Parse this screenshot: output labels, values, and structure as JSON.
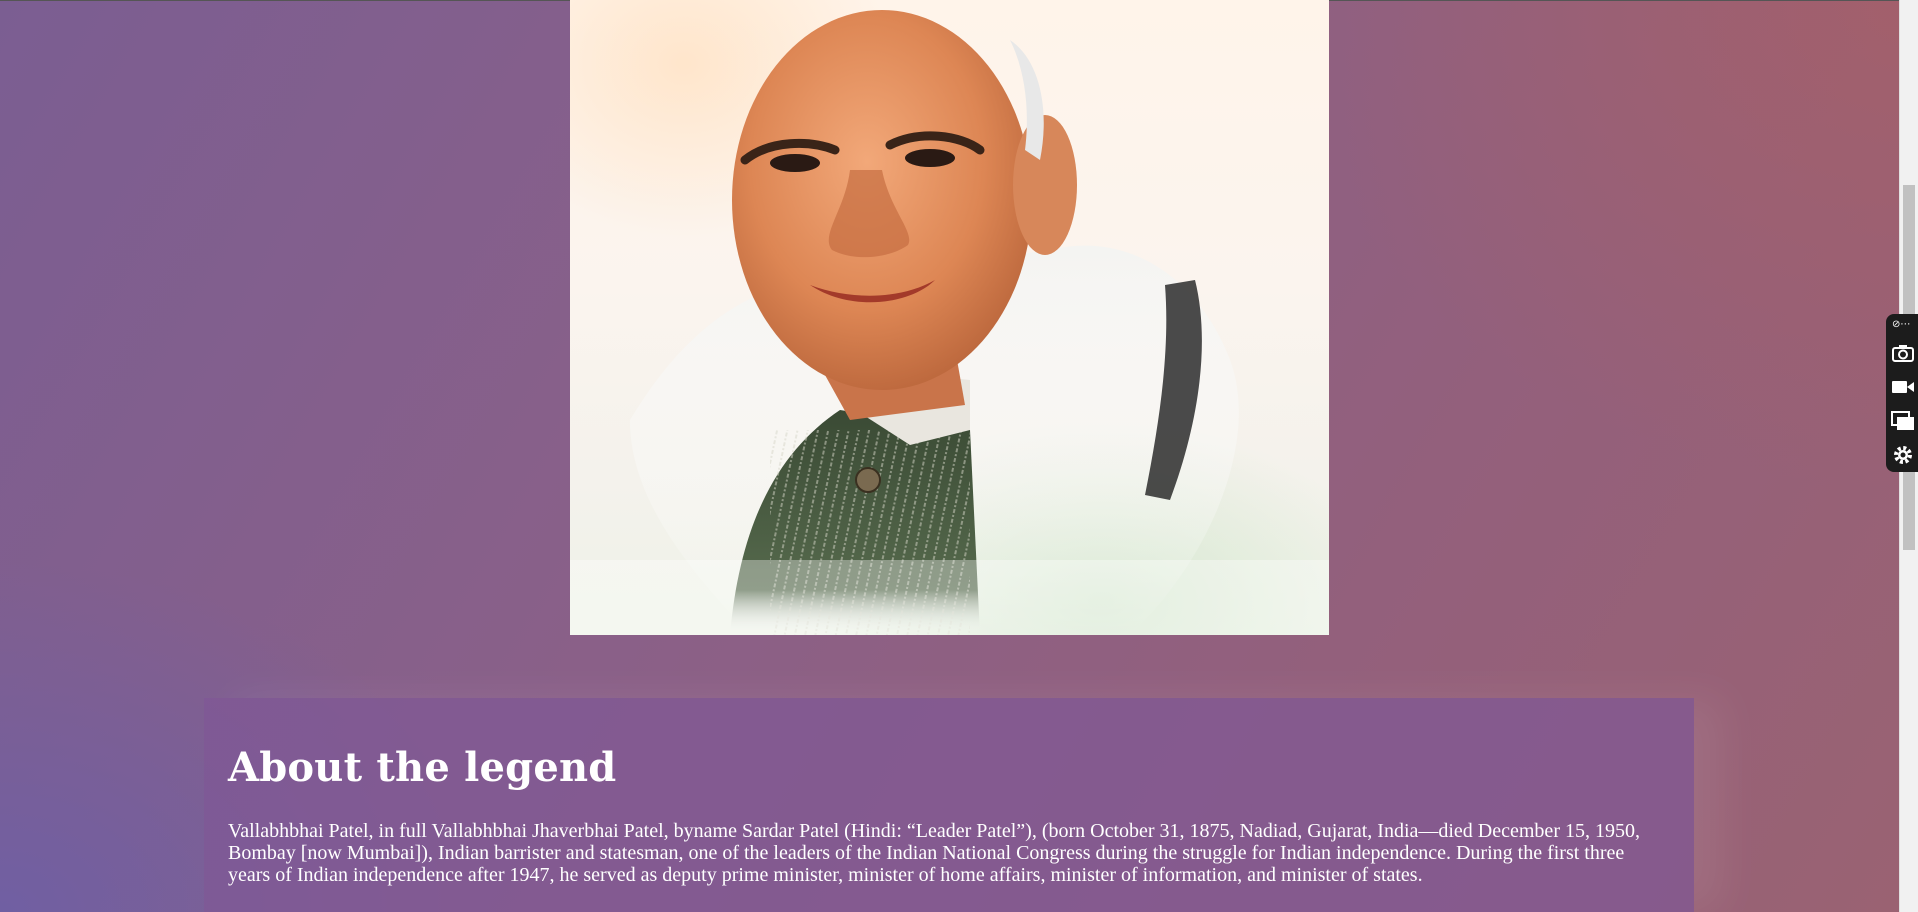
{
  "about": {
    "title": "About the legend",
    "text": "Vallabhbhai Patel, in full Vallabhbhai Jhaverbhai Patel, byname Sardar Patel (Hindi: “Leader Patel”), (born October 31, 1875, Nadiad, Gujarat, India—died December 15, 1950, Bombay [now Mumbai]), Indian barrister and statesman, one of the leaders of the Indian National Congress during the struggle for Indian independence. During the first three years of Indian independence after 1947, he served as deputy prime minister, minister of home affairs, minister of information, and minister of states."
  },
  "toolbar": {
    "menu_glyph": "⋯",
    "buttons": [
      "camera-icon",
      "video-camera-icon",
      "windows-icon",
      "gear-icon"
    ]
  },
  "colors": {
    "card_background": "#80589699",
    "text": "#ffffff",
    "toolbar_background": "#1c1c1c"
  }
}
